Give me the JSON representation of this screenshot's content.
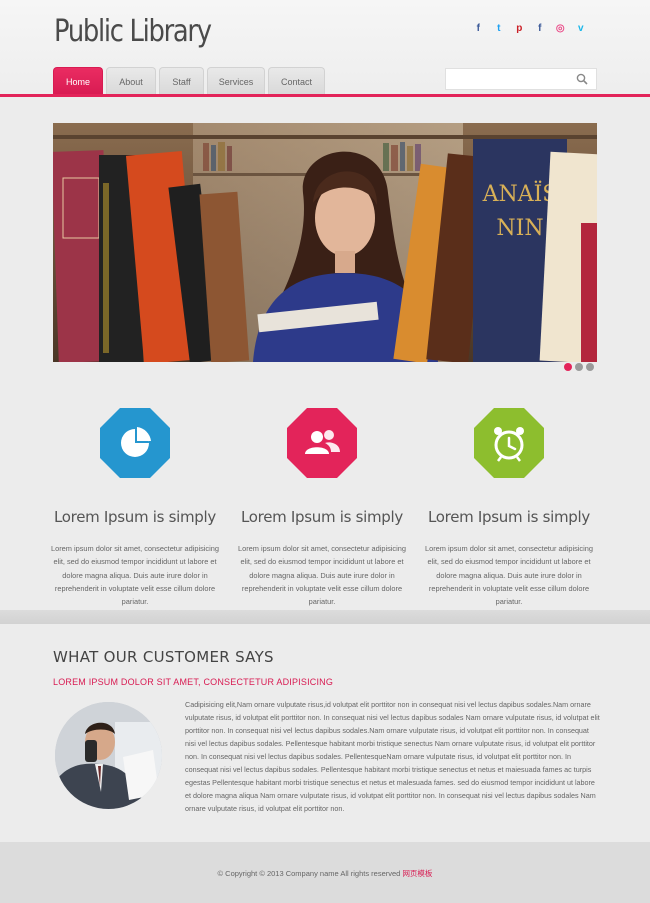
{
  "header": {
    "logo": "Public Library",
    "social": [
      {
        "icon": "facebook-icon",
        "glyph": "f",
        "color": "#3b5998"
      },
      {
        "icon": "twitter-icon",
        "glyph": "t",
        "color": "#1da1f2"
      },
      {
        "icon": "pinterest-icon",
        "glyph": "p",
        "color": "#cb2027"
      },
      {
        "icon": "facebook-icon",
        "glyph": "f",
        "color": "#3b5998"
      },
      {
        "icon": "dribbble-icon",
        "glyph": "◎",
        "color": "#ea4c89"
      },
      {
        "icon": "vimeo-icon",
        "glyph": "v",
        "color": "#1ab7ea"
      }
    ],
    "search_placeholder": ""
  },
  "nav": [
    {
      "label": "Home",
      "active": true
    },
    {
      "label": "About",
      "active": false
    },
    {
      "label": "Staff",
      "active": false
    },
    {
      "label": "Services",
      "active": false
    },
    {
      "label": "Contact",
      "active": false
    }
  ],
  "slider": {
    "dots": [
      true,
      false,
      false
    ]
  },
  "features": [
    {
      "icon": "pie-chart-icon",
      "color": "#2596cf",
      "title": "Lorem Ipsum is simply",
      "text": "Lorem ipsum dolor sit amet, consectetur adipisicing elit, sed do eiusmod tempor incididunt ut labore et dolore magna aliqua. Duis aute irure dolor in reprehenderit in voluptate velit esse cillum dolore pariatur."
    },
    {
      "icon": "users-icon",
      "color": "#e3245a",
      "title": "Lorem Ipsum is simply",
      "text": "Lorem ipsum dolor sit amet, consectetur adipisicing elit, sed do eiusmod tempor incididunt ut labore et dolore magna aliqua. Duis aute irure dolor in reprehenderit in voluptate velit esse cillum dolore pariatur."
    },
    {
      "icon": "alarm-clock-icon",
      "color": "#8dbe2e",
      "title": "Lorem Ipsum is simply",
      "text": "Lorem ipsum dolor sit amet, consectetur adipisicing elit, sed do eiusmod tempor incididunt ut labore et dolore magna aliqua. Duis aute irure dolor in reprehenderit in voluptate velit esse cillum dolore pariatur."
    }
  ],
  "testimonial": {
    "heading": "WHAT OUR CUSTOMER SAYS",
    "subheading": "LOREM IPSUM DOLOR SIT AMET, CONSECTETUR ADIPISICING",
    "text": "Cadipisicing elit,Nam ornare vulputate risus,id volutpat elit porttitor non in consequat nisi vel lectus dapibus sodales.Nam ornare vulputate risus, id volutpat elit porttitor non. In consequat nisi vel lectus dapibus sodales Nam ornare vulputate risus, id volutpat elit porttitor non. In consequat nisi vel lectus dapibus sodales.Nam ornare vulputate risus, id volutpat elit porttitor non. In consequat nisi vel lectus dapibus sodales. Pellentesque habitant morbi tristique senectus Nam ornare vulputate risus, id volutpat elit porttitor non. In consequat nisi vel lectus dapibus sodales. PellentesqueNam ornare vulputate risus, id volutpat elit porttitor non. In consequat nisi vel lectus dapibus sodales. Pellentesque habitant morbi tristique senectus et netus et maiesuada fames ac turpis egestas Pellentesque habitant morbi tristique senectus et netus et malesuada fames. sed do eiusmod tempor incididunt ut labore et dolore magna aliqua Nam ornare vulputate risus, id volutpat elit porttitor non. In consequat nisi vel lectus dapibus sodales Nam ornare vulputate risus, id volutpat elit porttitor non."
  },
  "footer": {
    "copyright": "© Copyright © 2013 Company name All rights reserved ",
    "link": "网页模板"
  },
  "colors": {
    "accent": "#e3245a"
  }
}
